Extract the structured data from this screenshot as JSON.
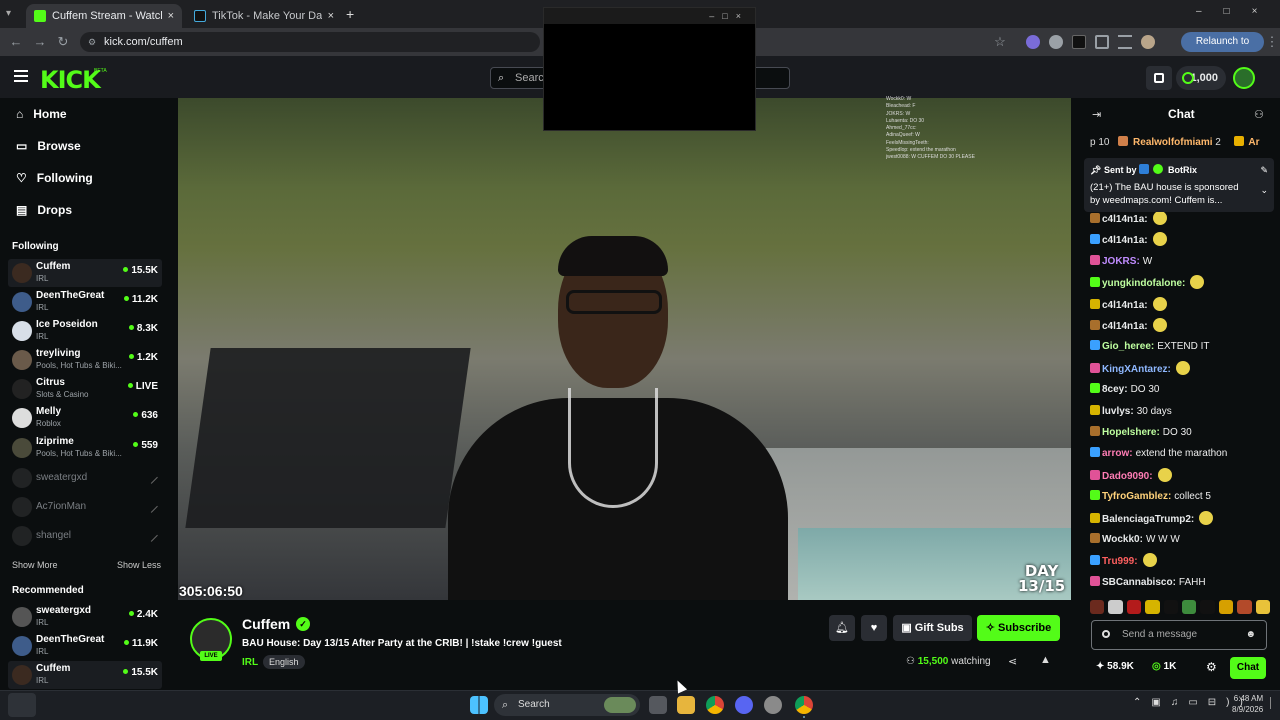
{
  "browser": {
    "tabs": [
      {
        "title": "Cuffem Stream - Watch Live",
        "active": true
      },
      {
        "title": "TikTok - Make Your Day",
        "active": false
      }
    ],
    "url": "kick.com/cuffem",
    "relaunch_label": "Relaunch to update"
  },
  "header": {
    "logo": "KICK",
    "beta": "BETA",
    "search_placeholder": "Search",
    "points": "1,000"
  },
  "sidebar": {
    "nav": [
      {
        "label": "Home",
        "icon": "home-icon"
      },
      {
        "label": "Browse",
        "icon": "browse-icon"
      },
      {
        "label": "Following",
        "icon": "heart-icon"
      },
      {
        "label": "Drops",
        "icon": "drops-icon"
      }
    ],
    "following_title": "Following",
    "following": [
      {
        "name": "Cuffem",
        "category": "IRL",
        "viewers": "15.5K"
      },
      {
        "name": "DeenTheGreat",
        "category": "IRL",
        "viewers": "11.2K"
      },
      {
        "name": "Ice Poseidon",
        "category": "IRL",
        "viewers": "8.3K"
      },
      {
        "name": "treyliving",
        "category": "Pools, Hot Tubs & Biki...",
        "viewers": "1.2K"
      },
      {
        "name": "Citrus",
        "category": "Slots & Casino",
        "viewers": "LIVE"
      },
      {
        "name": "Melly",
        "category": "Roblox",
        "viewers": "636"
      },
      {
        "name": "Iziprime",
        "category": "Pools, Hot Tubs & Biki...",
        "viewers": "559"
      }
    ],
    "offline": [
      "sweatergxd",
      "Ac7ionMan",
      "shangel"
    ],
    "show_more": "Show More",
    "show_less": "Show Less",
    "recommended_title": "Recommended",
    "recommended": [
      {
        "name": "sweatergxd",
        "category": "IRL",
        "viewers": "2.4K"
      },
      {
        "name": "DeenTheGreat",
        "category": "IRL",
        "viewers": "11.9K"
      },
      {
        "name": "Cuffem",
        "category": "IRL",
        "viewers": "15.5K"
      }
    ]
  },
  "video": {
    "uptime": "305:06:50",
    "overlay_day": "DAY",
    "overlay_count": "13/15",
    "overlay_chat": [
      "Wockk0: W",
      "Bleachead: F",
      "JOKRS: W",
      "Luhaenta: DO 30",
      "Ahmed_77cc:",
      "AdinaQueef: W",
      "FeelsMissingTeeth:",
      "Speedlop: extend the marathon",
      "jwest0088: W CUFFEM DO 30 PLEASE"
    ]
  },
  "stream": {
    "name": "Cuffem",
    "live_badge": "LIVE",
    "title": "BAU House: Day 13/15 After Party at the CRIB! | !stake !crew !guest",
    "category": "IRL",
    "language": "English",
    "gift_subs": "Gift Subs",
    "subscribe": "Subscribe",
    "viewers": "15,500",
    "watching_label": "watching"
  },
  "chat": {
    "title": "Chat",
    "gifters_prefix": "p 10",
    "gifter_name": "Realwolfofmiami",
    "gifter_count": "2",
    "gifter_2": "Ar",
    "pinned_sent_by": "Sent by",
    "pinned_user": "BotRix",
    "pinned_text": "(21+) The BAU house is sponsored by weedmaps.com! Cuffem is...",
    "messages": [
      {
        "user": "c4l14n1a:",
        "text": "",
        "color": "#e8eaeb",
        "emote": true
      },
      {
        "user": "c4l14n1a:",
        "text": "",
        "color": "#e8eaeb",
        "emote": true
      },
      {
        "user": "JOKRS:",
        "text": "W",
        "color": "#c08cff",
        "emote": false
      },
      {
        "user": "yungkindofalone:",
        "text": "",
        "color": "#bfffa0",
        "emote": true
      },
      {
        "user": "c4l14n1a:",
        "text": "",
        "color": "#e8eaeb",
        "emote": true
      },
      {
        "user": "c4l14n1a:",
        "text": "",
        "color": "#e8eaeb",
        "emote": true
      },
      {
        "user": "Gio_heree:",
        "text": "EXTEND IT",
        "color": "#bfffa0",
        "emote": false
      },
      {
        "user": "KingXAntarez:",
        "text": "",
        "color": "#8fb8ff",
        "emote": true
      },
      {
        "user": "8cey:",
        "text": "DO 30",
        "color": "#e8eaeb",
        "emote": false
      },
      {
        "user": "luvlys:",
        "text": "30 days",
        "color": "#e8eaeb",
        "emote": false
      },
      {
        "user": "Hopelshere:",
        "text": "DO 30",
        "color": "#bfffa0",
        "emote": false
      },
      {
        "user": "arrow:",
        "text": "extend the marathon",
        "color": "#ff7db5",
        "emote": false
      },
      {
        "user": "Dado9090:",
        "text": "",
        "color": "#ff7db5",
        "emote": true
      },
      {
        "user": "TyfroGamblez:",
        "text": "collect 5",
        "color": "#ffd27a",
        "emote": false
      },
      {
        "user": "BalenciagaTrump2:",
        "text": "",
        "color": "#e8eaeb",
        "emote": true
      },
      {
        "user": "Wockk0:",
        "text": "W W W",
        "color": "#e8eaeb",
        "emote": false
      },
      {
        "user": "Tru999:",
        "text": "",
        "color": "#ff5f5f",
        "emote": true
      },
      {
        "user": "SBCannabisco:",
        "text": "FAHH",
        "color": "#e8eaeb",
        "emote": false
      }
    ],
    "input_placeholder": "Send a message",
    "foot_count_1": "58.9K",
    "foot_count_2": "1K",
    "chat_button": "Chat"
  },
  "taskbar": {
    "search": "Search",
    "time": "6:48 AM",
    "date": "8/9/2026"
  },
  "colors": {
    "accent": "#53fc18",
    "bg": "#0b0e0f",
    "panel": "#191b1f"
  }
}
